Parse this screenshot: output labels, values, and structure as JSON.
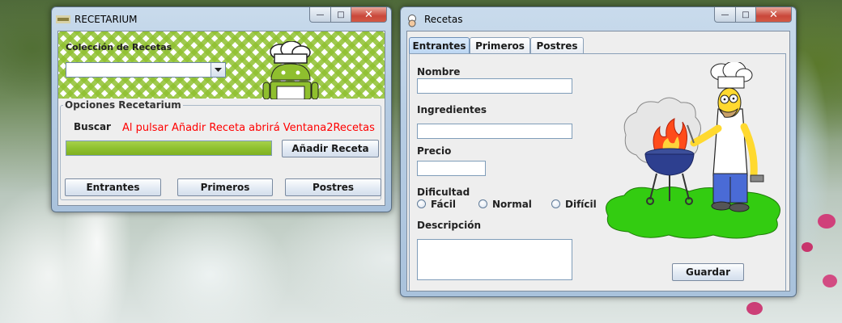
{
  "desktop": {},
  "win1": {
    "title": "RECETARIUM",
    "coleccion_label": "Colección de Recetas",
    "combo_value": "",
    "opciones_label": "Opciones Recetarium",
    "buscar_label": "Buscar",
    "info_text": "Al pulsar Añadir Receta abrirá Ventana2Recetas",
    "progress_value": 1.0,
    "add_button": "Añadir Receta",
    "buttons": [
      "Entrantes",
      "Primeros",
      "Postres"
    ],
    "accent_green": "#8fc130"
  },
  "win2": {
    "title": "Recetas",
    "tabs": [
      "Entrantes",
      "Primeros",
      "Postres"
    ],
    "active_tab": "Entrantes",
    "nombre_label": "Nombre",
    "ingredientes_label": "Ingredientes",
    "precio_label": "Precio",
    "dificultad_label": "Dificultad",
    "dificultad_options": [
      "Fácil",
      "Normal",
      "Difícil"
    ],
    "descripcion_label": "Descripción",
    "guardar_button": "Guardar"
  }
}
